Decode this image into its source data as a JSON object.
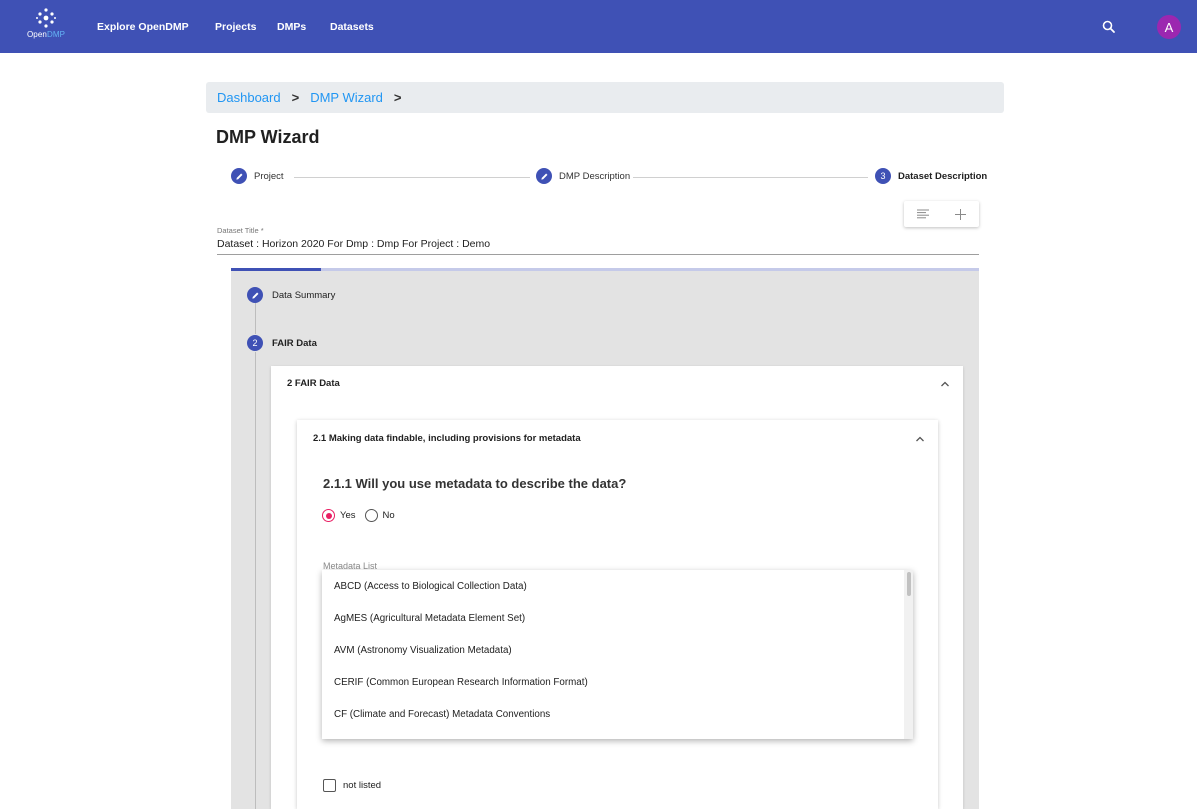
{
  "topbar": {
    "logo": {
      "text_open": "Open",
      "text_dmp": "DMP"
    },
    "nav": {
      "explore": "Explore OpenDMP",
      "projects": "Projects",
      "dmps": "DMPs",
      "datasets": "Datasets"
    },
    "avatar_letter": "A",
    "colors": {
      "bar": "#3f51b5",
      "avatar": "#9c27b0",
      "logo_accent": "#64b5f6"
    }
  },
  "breadcrumb": {
    "items": [
      "Dashboard",
      "DMP Wizard"
    ],
    "separator": ">"
  },
  "page_title": "DMP Wizard",
  "wizard_steps": [
    {
      "icon": "pencil-icon",
      "label": "Project",
      "state": "edited"
    },
    {
      "icon": "pencil-icon",
      "label": "DMP Description",
      "state": "edited"
    },
    {
      "number": "3",
      "label": "Dataset Description",
      "state": "active"
    }
  ],
  "dataset_title": {
    "label": "Dataset Title *",
    "value": "Dataset : Horizon 2020 For Dmp : Dmp For Project : Demo"
  },
  "section_progress": 0.12,
  "sections": [
    {
      "icon": "pencil-icon",
      "label": "Data Summary"
    },
    {
      "number": "2",
      "label": "FAIR Data"
    }
  ],
  "outer_card": {
    "title": "2 FAIR Data",
    "expanded": true
  },
  "inner_card": {
    "title": "2.1 Making data findable, including provisions for metadata",
    "expanded": true
  },
  "question": {
    "text": "2.1.1 Will you use metadata to describe the data?",
    "options": [
      "Yes",
      "No"
    ],
    "selected": "Yes"
  },
  "metadata_list": {
    "label": "Metadata List",
    "options": [
      "ABCD (Access to Biological Collection Data)",
      "AgMES (Agricultural Metadata Element Set)",
      "AVM (Astronomy Visualization Metadata)",
      "CERIF (Common European Research Information Format)",
      "CF (Climate and Forecast) Metadata Conventions"
    ]
  },
  "not_listed": {
    "label": "not listed",
    "checked": false
  },
  "accent_colors": {
    "primary": "#3f51b5",
    "radio": "#e91e63",
    "link": "#2196f3"
  }
}
